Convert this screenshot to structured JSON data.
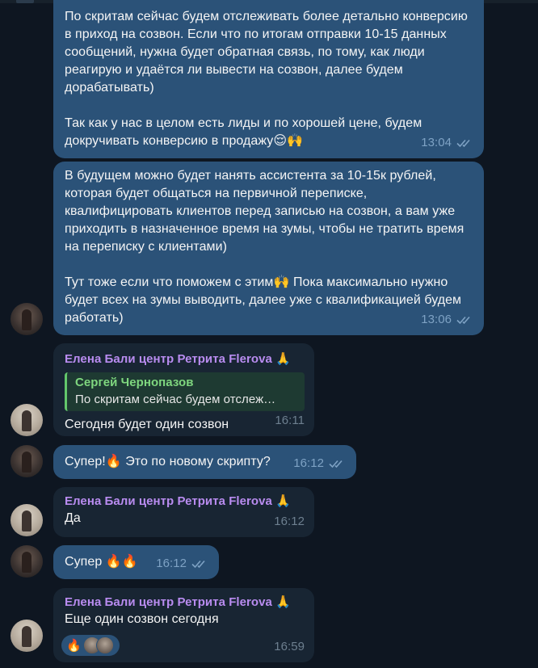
{
  "chat": {
    "messages": [
      {
        "id": "m1",
        "direction": "outgoing",
        "text": "По скритам сейчас будем отслеживать более детально конверсию в приход на созвон. Если что по итогам отправки 10-15 данных сообщений, нужна будет обратная связь, по тому, как люди реагирую и удаётся ли вывести на созвон, далее будем дорабатывать)\n\nТак как у нас в целом есть лиды и по хорошей цене, будем докручивать конверсию в продажу",
        "emoji": "😌🙌",
        "time": "13:04",
        "status": "read"
      },
      {
        "id": "m2",
        "direction": "outgoing",
        "text_part1": "В будущем можно будет нанять ассистента за 10-15к рублей, которая будет общаться на первичной переписке, квалифицировать клиентов перед записью на созвон, а вам уже приходить в назначенное время на зумы, чтобы не тратить время на переписку с клиентами)\n\nТут тоже если что поможем с этим",
        "emoji": "🙌",
        "text_part2": " Пока максимально нужно будет всех на зумы выводить, далее уже с квалификацией будем работать)",
        "time": "13:06",
        "status": "read"
      },
      {
        "id": "m3",
        "direction": "incoming",
        "sender": "Елена Бали центр Ретрита Flerova",
        "sender_emoji": "🙏",
        "reply_to": {
          "name": "Сергей Чернопазов",
          "text": "По скритам сейчас будем отслеж…"
        },
        "text": "Сегодня будет один созвон",
        "time": "16:11"
      },
      {
        "id": "m4",
        "direction": "outgoing",
        "text_part1": "Супер!",
        "emoji": "🔥",
        "text_part2": " Это по новому скрипту?",
        "time": "16:12",
        "status": "read"
      },
      {
        "id": "m5",
        "direction": "incoming",
        "sender": "Елена Бали центр Ретрита Flerova",
        "sender_emoji": "🙏",
        "text": "Да",
        "time": "16:12"
      },
      {
        "id": "m6",
        "direction": "outgoing",
        "text": "Супер",
        "emoji": "🔥🔥",
        "time": "16:12",
        "status": "read"
      },
      {
        "id": "m7",
        "direction": "incoming",
        "sender": "Елена Бали центр Ретрита Flerova",
        "sender_emoji": "🙏",
        "text": "Еще один созвон сегодня",
        "reaction_emoji": "🔥",
        "time": "16:59"
      }
    ]
  },
  "colors": {
    "background": "#0e1621",
    "outgoing_bubble": "#2b5278",
    "incoming_bubble": "#182533",
    "sender_name": "#b98cf0",
    "reply_accent": "#63c76b",
    "read_ticks": "#7ea2c4"
  },
  "icons": [
    "avatar",
    "double-check-icon",
    "fire-emoji",
    "raised-hands-emoji",
    "pray-emoji",
    "relieved-emoji"
  ]
}
